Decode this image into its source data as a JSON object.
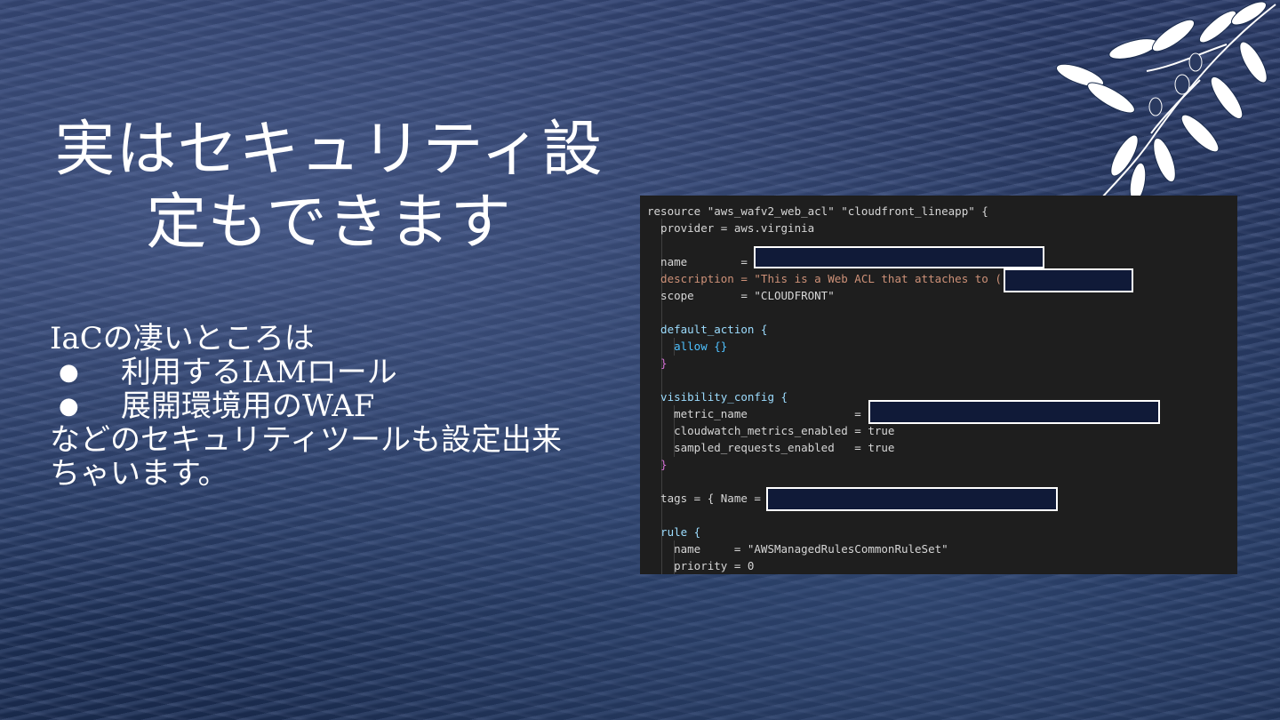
{
  "slide": {
    "title_line1": "実はセキュリティ設",
    "title_line2": "定もできます",
    "intro": "IaCの凄いところは",
    "bullets": [
      "利用するIAMロール",
      "展開環境用のWAF"
    ],
    "bullet_marker": "●",
    "closing_line1": "などのセキュリティツールも設定出来",
    "closing_line2": "ちゃいます。"
  },
  "code": {
    "lines": [
      "resource \"aws_wafv2_web_acl\" \"cloudfront_lineapp\" {",
      "  provider = aws.virginia",
      "  name        =",
      "  description = \"This is a Web ACL that attaches to (",
      "  scope       = \"CLOUDFRONT\"",
      "  default_action {",
      "    allow {}",
      "  }",
      "  visibility_config {",
      "    metric_name                =",
      "    cloudwatch_metrics_enabled = true",
      "    sampled_requests_enabled   = true",
      "  }",
      "  tags = { Name =",
      "  rule {",
      "    name     = \"AWSManagedRulesCommonRuleSet\"",
      "    priority = 0"
    ]
  },
  "colors": {
    "code_bg": "#1e1e1e",
    "redaction_fill": "#101a38",
    "string": "#ce9178",
    "keyword": "#9cdcfe",
    "bool": "#569cd6",
    "brace": "#d16fd1"
  },
  "decor": {
    "icon": "olive-branch-icon"
  }
}
